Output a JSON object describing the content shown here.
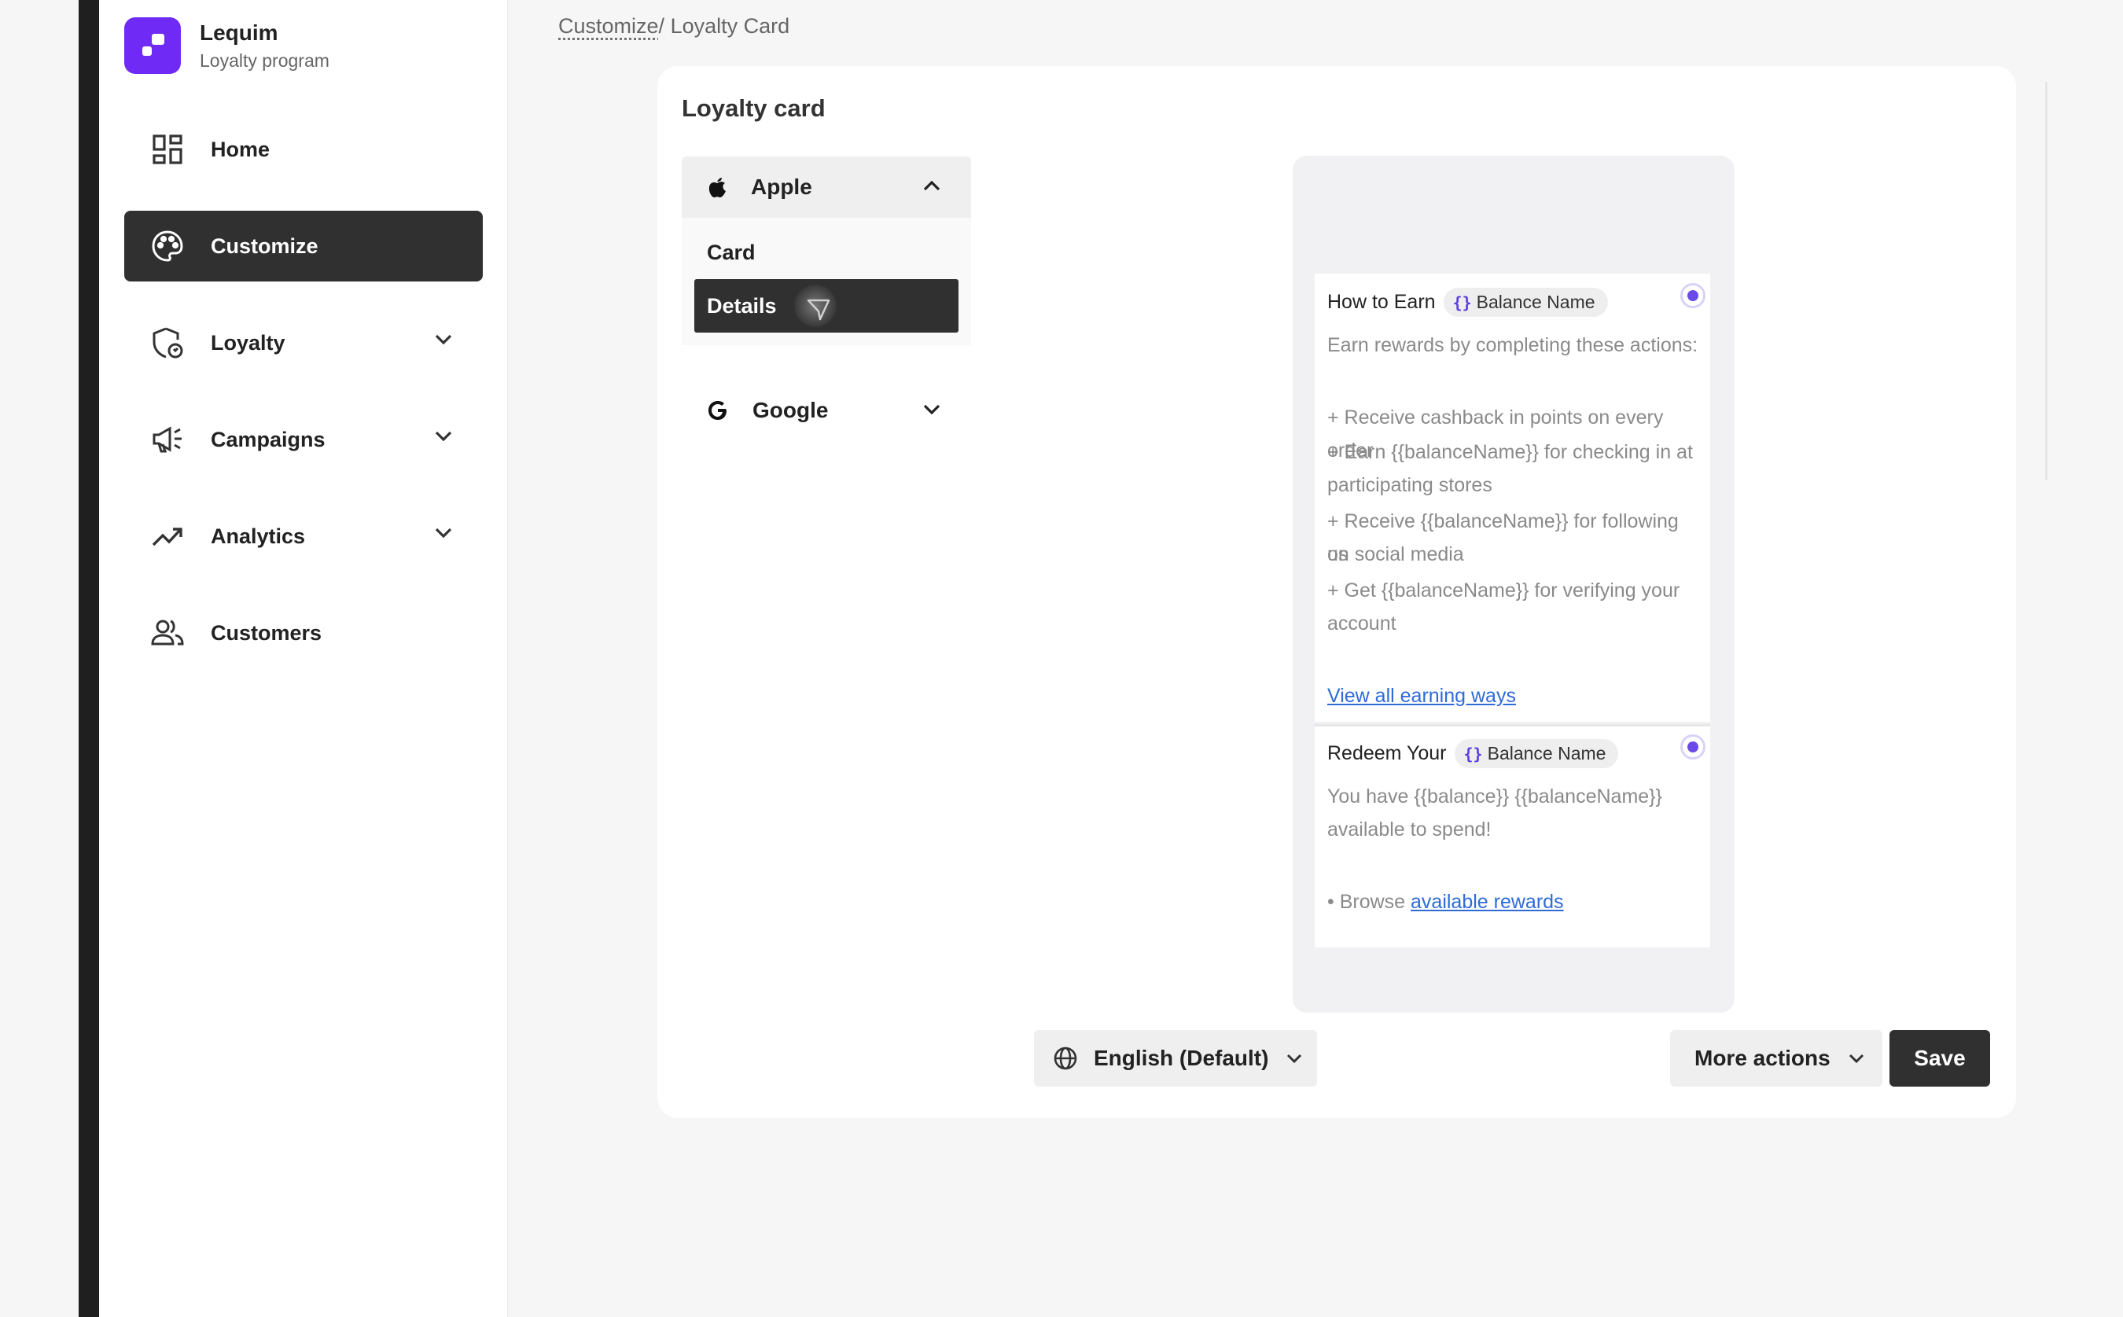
{
  "brand": {
    "name": "Lequim",
    "subtitle": "Loyalty program"
  },
  "nav": {
    "items": [
      {
        "label": "Home",
        "icon": "dashboard-icon"
      },
      {
        "label": "Customize",
        "icon": "palette-icon",
        "active": true
      },
      {
        "label": "Loyalty",
        "icon": "shield-icon",
        "expandable": true
      },
      {
        "label": "Campaigns",
        "icon": "megaphone-icon",
        "expandable": true
      },
      {
        "label": "Analytics",
        "icon": "trending-up-icon",
        "expandable": true
      },
      {
        "label": "Customers",
        "icon": "people-icon"
      }
    ]
  },
  "breadcrumb": {
    "parent": "Customize",
    "separator": "/ ",
    "current": "Loyalty Card"
  },
  "card": {
    "title": "Loyalty card"
  },
  "platforms": {
    "apple": {
      "label": "Apple",
      "sub_items": [
        "Card",
        "Details"
      ],
      "selected": "Details"
    },
    "google": {
      "label": "Google"
    }
  },
  "preview": {
    "earn": {
      "heading": "How to Earn",
      "chip": "Balance Name",
      "intro": "Earn rewards by completing these actions:",
      "line1": "+ Receive cashback in points on every order",
      "line2a": "+ Earn {{balanceName}} for checking in at",
      "line2b": "participating stores",
      "line3a": "+ Receive {{balanceName}} for following us",
      "line3b": "on social media",
      "line4a": "+ Get {{balanceName}} for verifying your",
      "line4b": "account",
      "link": "View all earning ways"
    },
    "redeem": {
      "heading": "Redeem Your",
      "chip": "Balance Name",
      "line1": "You have {{balance}} {{balanceName}}",
      "line2": "available to spend!",
      "browse_prefix": "• Browse",
      "browse_link": "available rewards"
    }
  },
  "footer": {
    "language": "English (Default)",
    "more_actions": "More actions",
    "save": "Save"
  },
  "colors": {
    "brand": "#6f2bf5",
    "dark": "#303030",
    "link": "#2f6bd8",
    "accent": "#6a49e8"
  }
}
